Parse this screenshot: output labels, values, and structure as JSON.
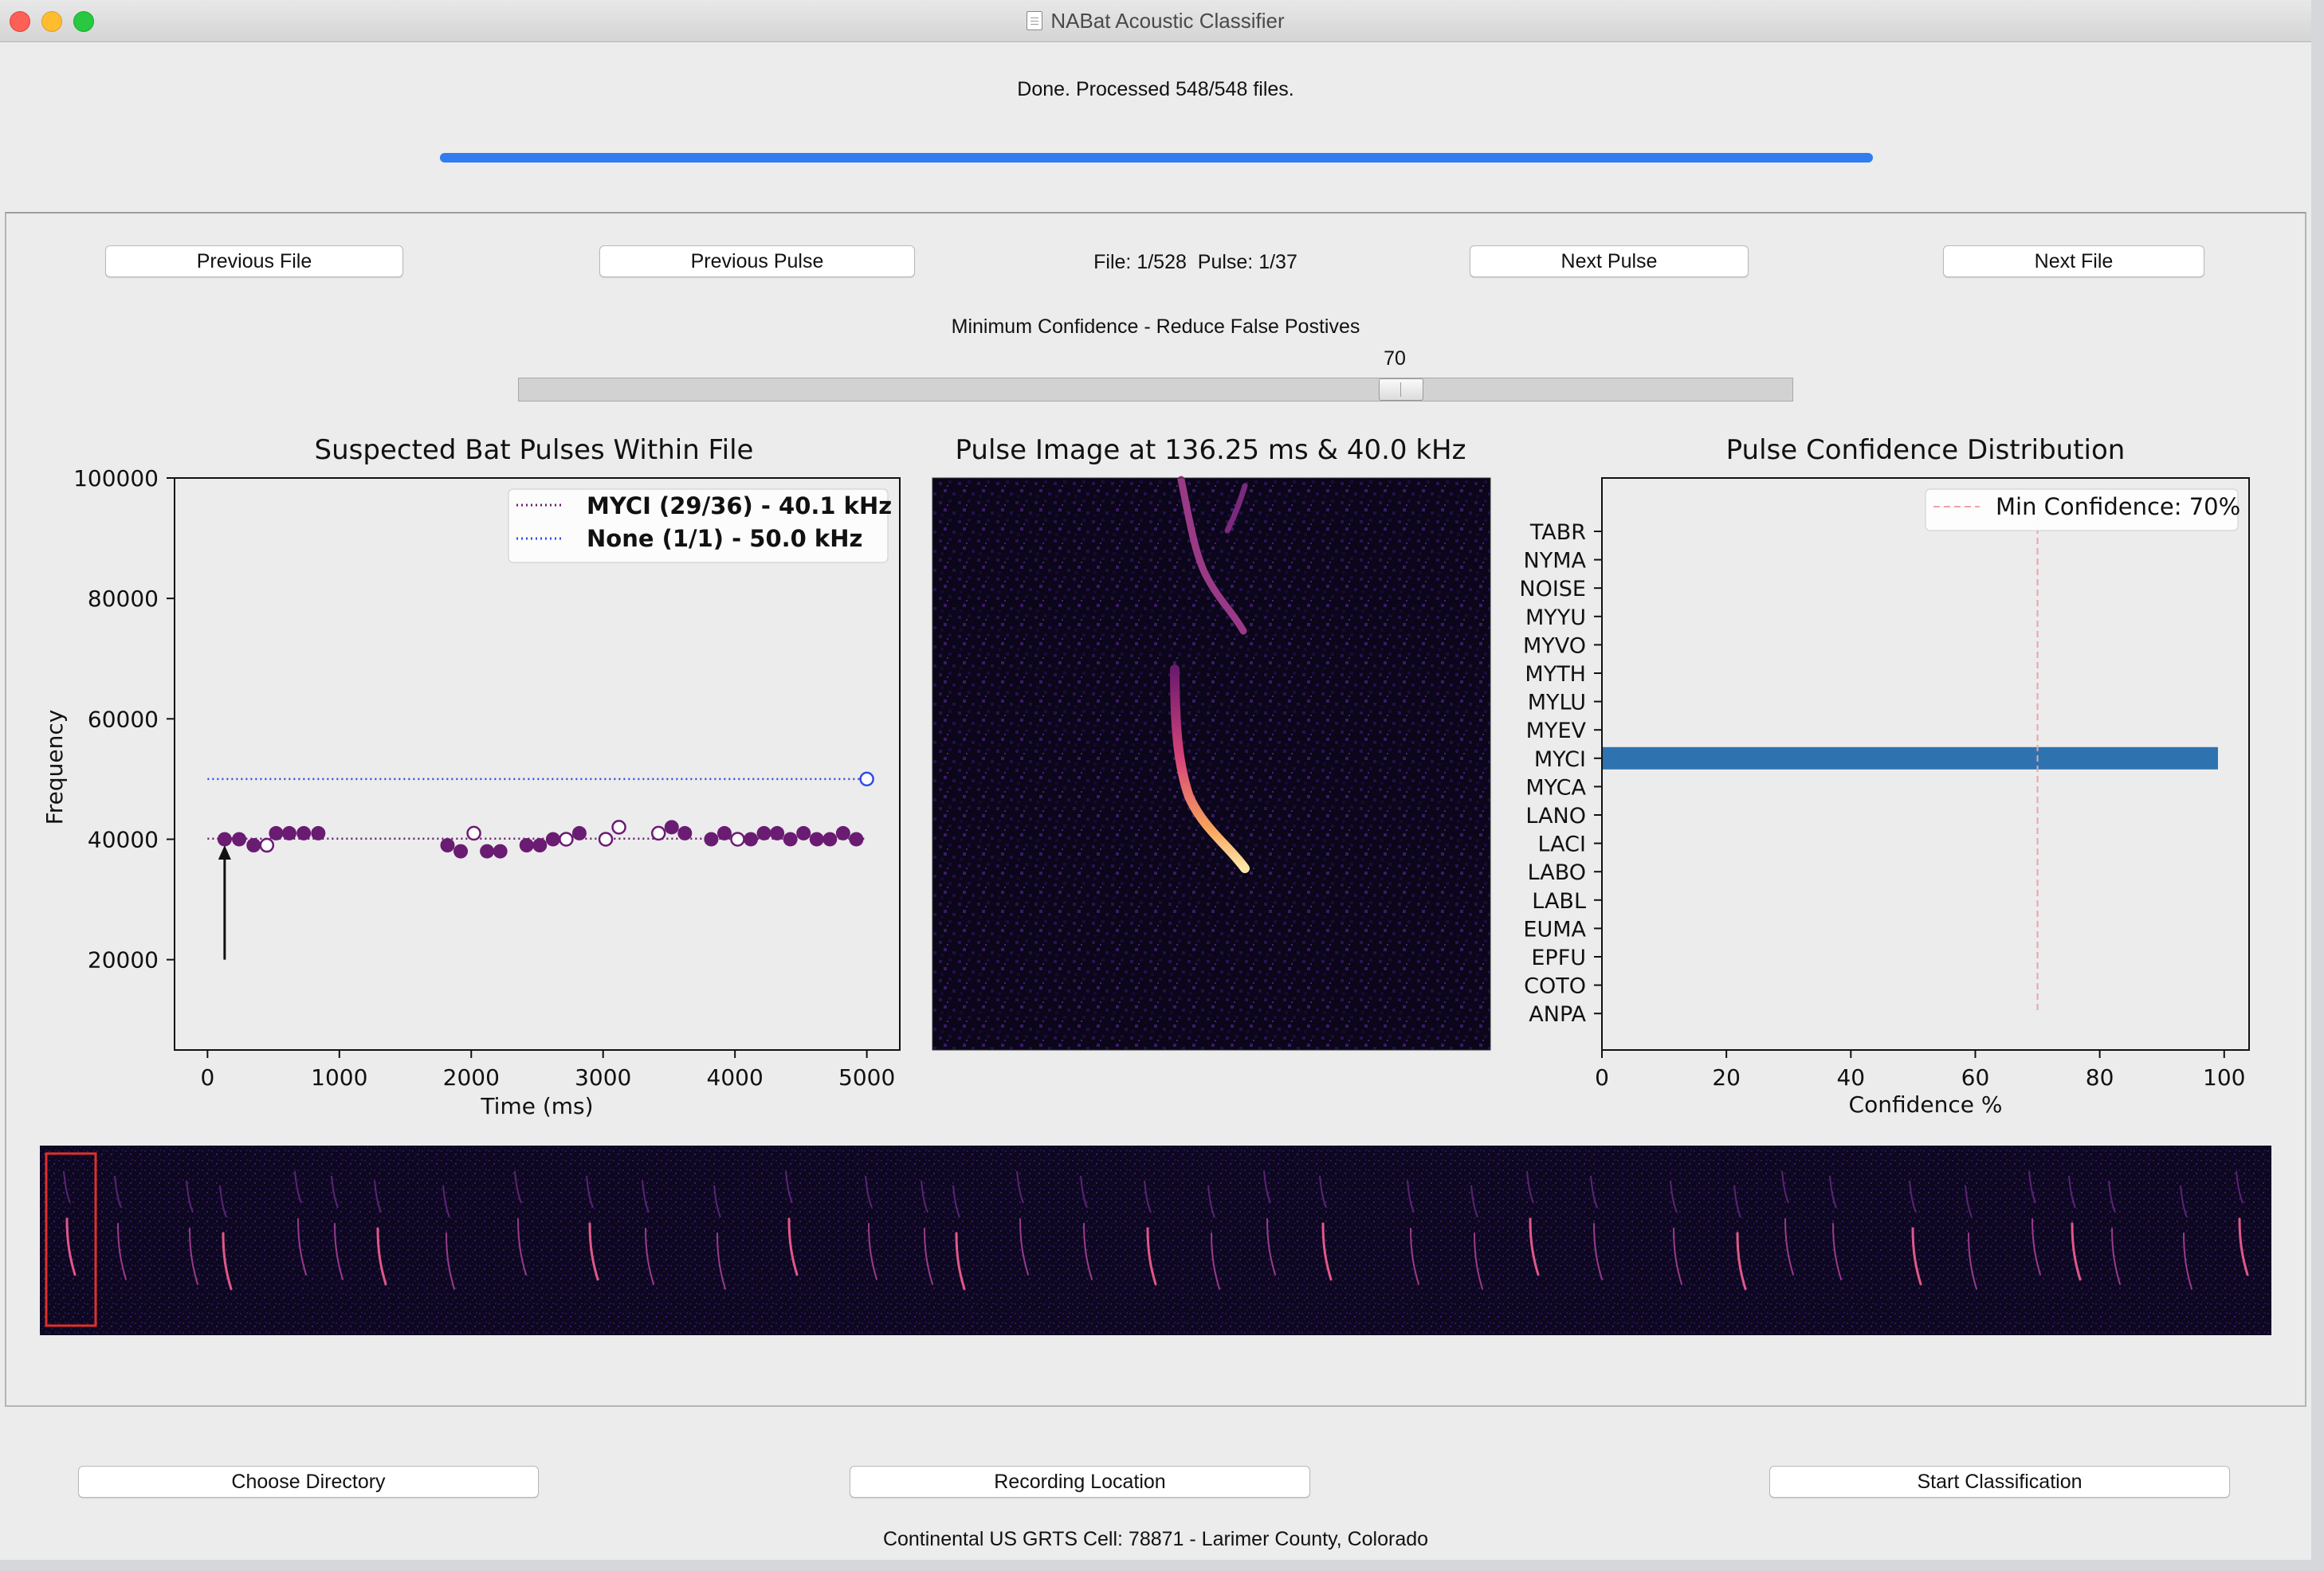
{
  "window": {
    "title": "NABat Acoustic Classifier"
  },
  "status": {
    "text": "Done. Processed 548/548 files.",
    "progress": 1.0
  },
  "nav": {
    "previous_file": "Previous File",
    "previous_pulse": "Previous Pulse",
    "position": "File: 1/528  Pulse: 1/37",
    "next_pulse": "Next Pulse",
    "next_file": "Next File"
  },
  "confidence_slider": {
    "label": "Minimum Confidence - Reduce False Postives",
    "value": 70,
    "min": 0,
    "max": 100
  },
  "bottom": {
    "choose_directory": "Choose Directory",
    "recording_location": "Recording Location",
    "start_classification": "Start Classification",
    "location_text": "Continental US GRTS Cell: 78871 - Larimer County, Colorado"
  },
  "colors": {
    "myci": "#6a1b72",
    "none": "#2f4de6",
    "bar": "#2e73b0",
    "accent": "#2f7df0"
  },
  "chart_data": [
    {
      "type": "scatter",
      "title": "Suspected Bat Pulses Within File",
      "xlabel": "Time (ms)",
      "ylabel": "Frequency",
      "xlim": [
        -250,
        5250
      ],
      "ylim": [
        5000,
        100000
      ],
      "xticks": [
        0,
        1000,
        2000,
        3000,
        4000,
        5000
      ],
      "yticks": [
        20000,
        40000,
        60000,
        80000,
        100000
      ],
      "legend_position": "top-right",
      "annotation_arrow": {
        "x": 130,
        "from_y": 20000,
        "to_y": 39000
      },
      "series": [
        {
          "name": "MYCI (29/36) - 40.1 kHz",
          "color": "#6a1b72",
          "reference_line": 40100,
          "x_range": [
            0,
            5000
          ],
          "filled": [
            [
              130,
              40000
            ],
            [
              240,
              40000
            ],
            [
              350,
              39000
            ],
            [
              520,
              41000
            ],
            [
              620,
              41000
            ],
            [
              730,
              41000
            ],
            [
              840,
              41000
            ],
            [
              1820,
              39000
            ],
            [
              1920,
              38000
            ],
            [
              2120,
              38000
            ],
            [
              2220,
              38000
            ],
            [
              2420,
              39000
            ],
            [
              2520,
              39000
            ],
            [
              2620,
              40000
            ],
            [
              2820,
              41000
            ],
            [
              3520,
              42000
            ],
            [
              3620,
              41000
            ],
            [
              3820,
              40000
            ],
            [
              3920,
              41000
            ],
            [
              4120,
              40000
            ],
            [
              4220,
              41000
            ],
            [
              4320,
              41000
            ],
            [
              4420,
              40000
            ],
            [
              4520,
              41000
            ],
            [
              4620,
              40000
            ],
            [
              4720,
              40000
            ],
            [
              4820,
              41000
            ],
            [
              4920,
              40000
            ]
          ],
          "hollow": [
            [
              450,
              39000
            ],
            [
              2020,
              41000
            ],
            [
              2720,
              40000
            ],
            [
              3020,
              40000
            ],
            [
              3120,
              42000
            ],
            [
              3420,
              41000
            ],
            [
              4020,
              40000
            ]
          ]
        },
        {
          "name": "None (1/1) - 50.0 kHz",
          "color": "#2f4de6",
          "reference_line": 50000,
          "x_range": [
            0,
            5000
          ],
          "filled": [],
          "hollow": [
            [
              5000,
              50000
            ]
          ]
        }
      ]
    },
    {
      "type": "heatmap",
      "title": "Pulse Image at 136.25 ms & 40.0 kHz"
    },
    {
      "type": "bar",
      "orientation": "horizontal",
      "title": "Pulse Confidence Distribution",
      "xlabel": "Confidence %",
      "xlim": [
        0,
        104
      ],
      "xticks": [
        0,
        20,
        40,
        60,
        80,
        100
      ],
      "legend_position": "top-right",
      "threshold": {
        "label": "Min Confidence: 70%",
        "value": 70
      },
      "categories": [
        "TABR",
        "NYMA",
        "NOISE",
        "MYYU",
        "MYVO",
        "MYTH",
        "MYLU",
        "MYEV",
        "MYCI",
        "MYCA",
        "LANO",
        "LACI",
        "LABO",
        "LABL",
        "EUMA",
        "EPFU",
        "COTO",
        "ANPA"
      ],
      "values": [
        0,
        0,
        0,
        0,
        0,
        0,
        0,
        0,
        99,
        0,
        0,
        0,
        0,
        0,
        0,
        0,
        0,
        0
      ]
    },
    {
      "type": "heatmap",
      "title": "",
      "selected_pulse_index": 0
    }
  ]
}
